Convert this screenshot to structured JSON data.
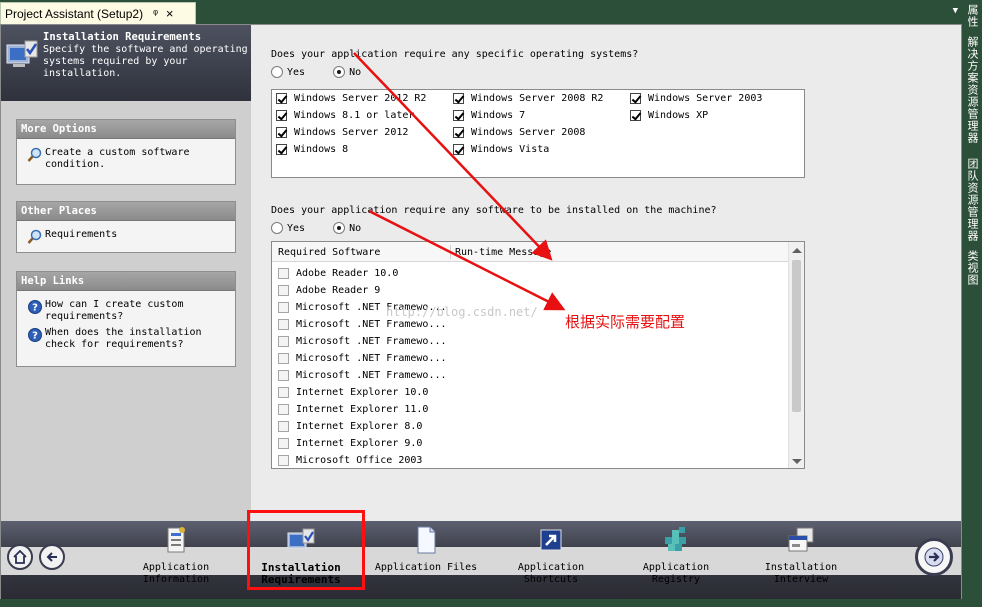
{
  "tab": {
    "title": "Project Assistant (Setup2)",
    "pin": "ᵠ",
    "close": "×"
  },
  "right_tabs": [
    "属性",
    "解决方案资源管理器",
    "团队资源管理器",
    "类视图"
  ],
  "header": {
    "title": "Installation Requirements",
    "description": "Specify the software and operating systems required by your installation."
  },
  "panels": {
    "more_options": {
      "title": "More Options",
      "items": [
        "Create a custom software condition."
      ]
    },
    "other_places": {
      "title": "Other Places",
      "items": [
        "Requirements"
      ]
    },
    "help_links": {
      "title": "Help Links",
      "items": [
        "How can I create custom requirements?",
        "When does the installation check for requirements?"
      ]
    }
  },
  "os_question": {
    "text": "Does your application require any specific operating systems?",
    "yes": "Yes",
    "no": "No",
    "selected": "No"
  },
  "os_list": [
    {
      "label": "Windows Server 2012 R2",
      "checked": true
    },
    {
      "label": "Windows 8.1 or later",
      "checked": true
    },
    {
      "label": "Windows Server 2012",
      "checked": true
    },
    {
      "label": "Windows 8",
      "checked": true
    },
    {
      "label": "Windows Server 2008 R2",
      "checked": true
    },
    {
      "label": "Windows 7",
      "checked": true
    },
    {
      "label": "Windows Server 2008",
      "checked": true
    },
    {
      "label": "Windows Vista",
      "checked": true
    },
    {
      "label": "Windows Server 2003",
      "checked": true
    },
    {
      "label": "Windows XP",
      "checked": true
    }
  ],
  "sw_question": {
    "text": "Does your application require any software to be installed on the machine?",
    "yes": "Yes",
    "no": "No",
    "selected": "No"
  },
  "sw_table": {
    "col1": "Required Software",
    "col2": "Run-time Message",
    "rows": [
      "Adobe Reader 10.0",
      "Adobe Reader 9",
      "Microsoft .NET Framewo...",
      "Microsoft .NET Framewo...",
      "Microsoft .NET Framewo...",
      "Microsoft .NET Framewo...",
      "Microsoft .NET Framewo...",
      "Internet Explorer 10.0",
      "Internet Explorer 11.0",
      "Internet Explorer 8.0",
      "Internet Explorer 9.0",
      "Microsoft Office 2003"
    ]
  },
  "annotation": "根据实际需要配置",
  "watermark": "http://blog.csdn.net/",
  "nav": [
    {
      "label": "Application Information",
      "active": false
    },
    {
      "label": "Installation Requirements",
      "active": true
    },
    {
      "label": "Application Files",
      "active": false
    },
    {
      "label": "Application Shortcuts",
      "active": false
    },
    {
      "label": "Application Registry",
      "active": false
    },
    {
      "label": "Installation Interview",
      "active": false
    }
  ],
  "colors": {
    "annotation": "#e81010",
    "highlight_box": "#ff1010",
    "header_bg": "#3a3d48"
  }
}
